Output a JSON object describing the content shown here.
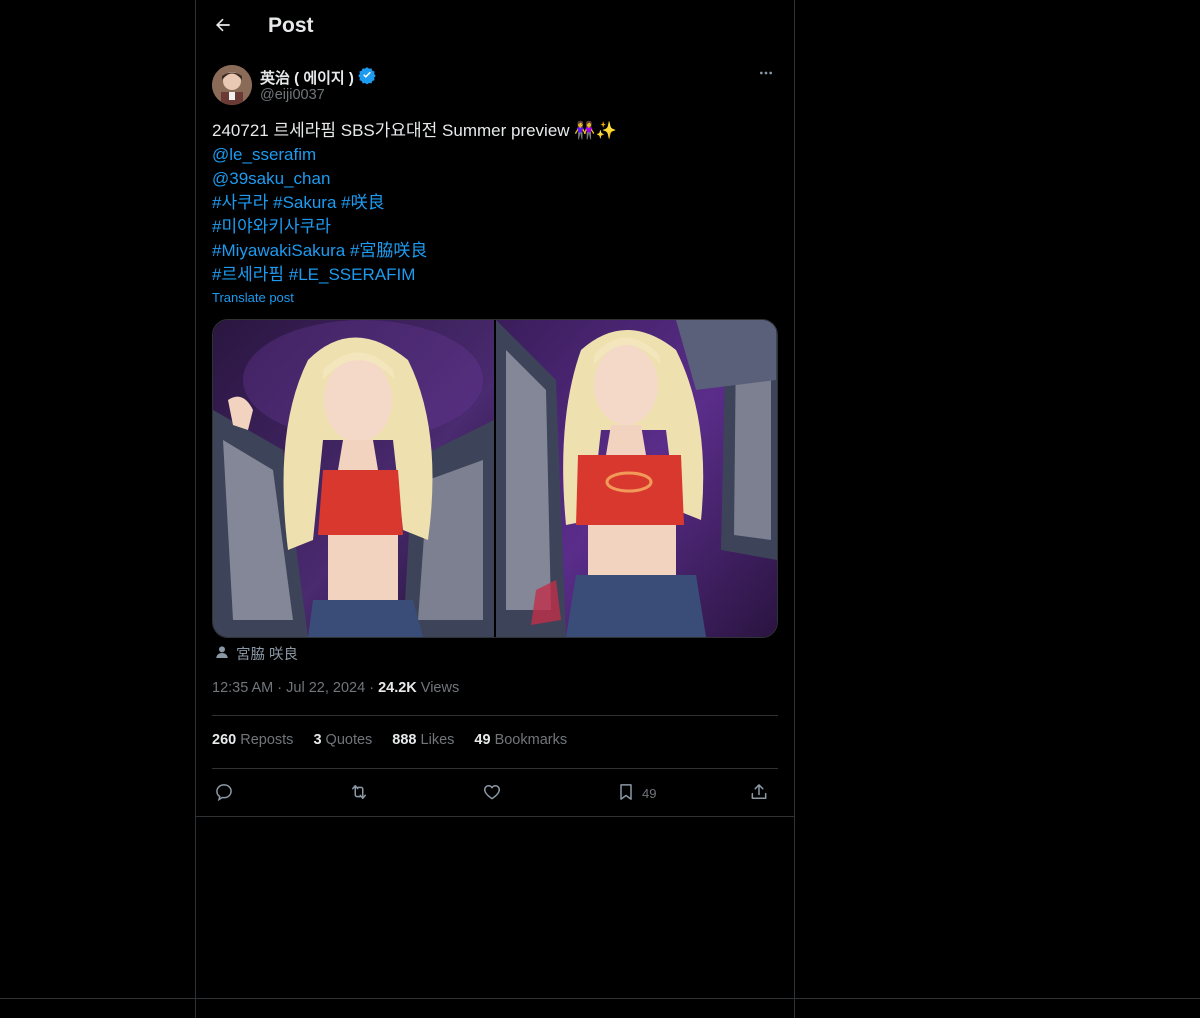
{
  "header": {
    "title": "Post"
  },
  "author": {
    "display_name": "英治 ( 에이지 )",
    "handle": "@eiji0037",
    "verified": true,
    "verified_color": "#1d9bf0"
  },
  "post": {
    "text_line1": "240721 르세라핌 SBS가요대전 Summer preview",
    "emoji": "👭✨",
    "mention1": "@le_sserafim",
    "mention2": "@39saku_chan",
    "hashtags_line1": [
      "#사쿠라",
      "#Sakura",
      "#咲良"
    ],
    "hashtags_line2": [
      "#미야와키사쿠라"
    ],
    "hashtags_line3": [
      "#MiyawakiSakura",
      "#宮脇咲良"
    ],
    "hashtags_line4": [
      "#르세라핌",
      "#LE_SSERAFIM"
    ],
    "translate_label": "Translate post"
  },
  "media": {
    "tagged_person": "宮脇 咲良"
  },
  "meta": {
    "time": "12:35 AM",
    "date": "Jul 22, 2024",
    "views_count": "24.2K",
    "views_label": "Views"
  },
  "stats": {
    "reposts_count": "260",
    "reposts_label": "Reposts",
    "quotes_count": "3",
    "quotes_label": "Quotes",
    "likes_count": "888",
    "likes_label": "Likes",
    "bookmarks_count": "49",
    "bookmarks_label": "Bookmarks"
  },
  "actions": {
    "bookmark_count": "49"
  },
  "colors": {
    "accent": "#1d9bf0",
    "background": "#000000",
    "border": "#2f3336",
    "muted": "#71767b"
  }
}
